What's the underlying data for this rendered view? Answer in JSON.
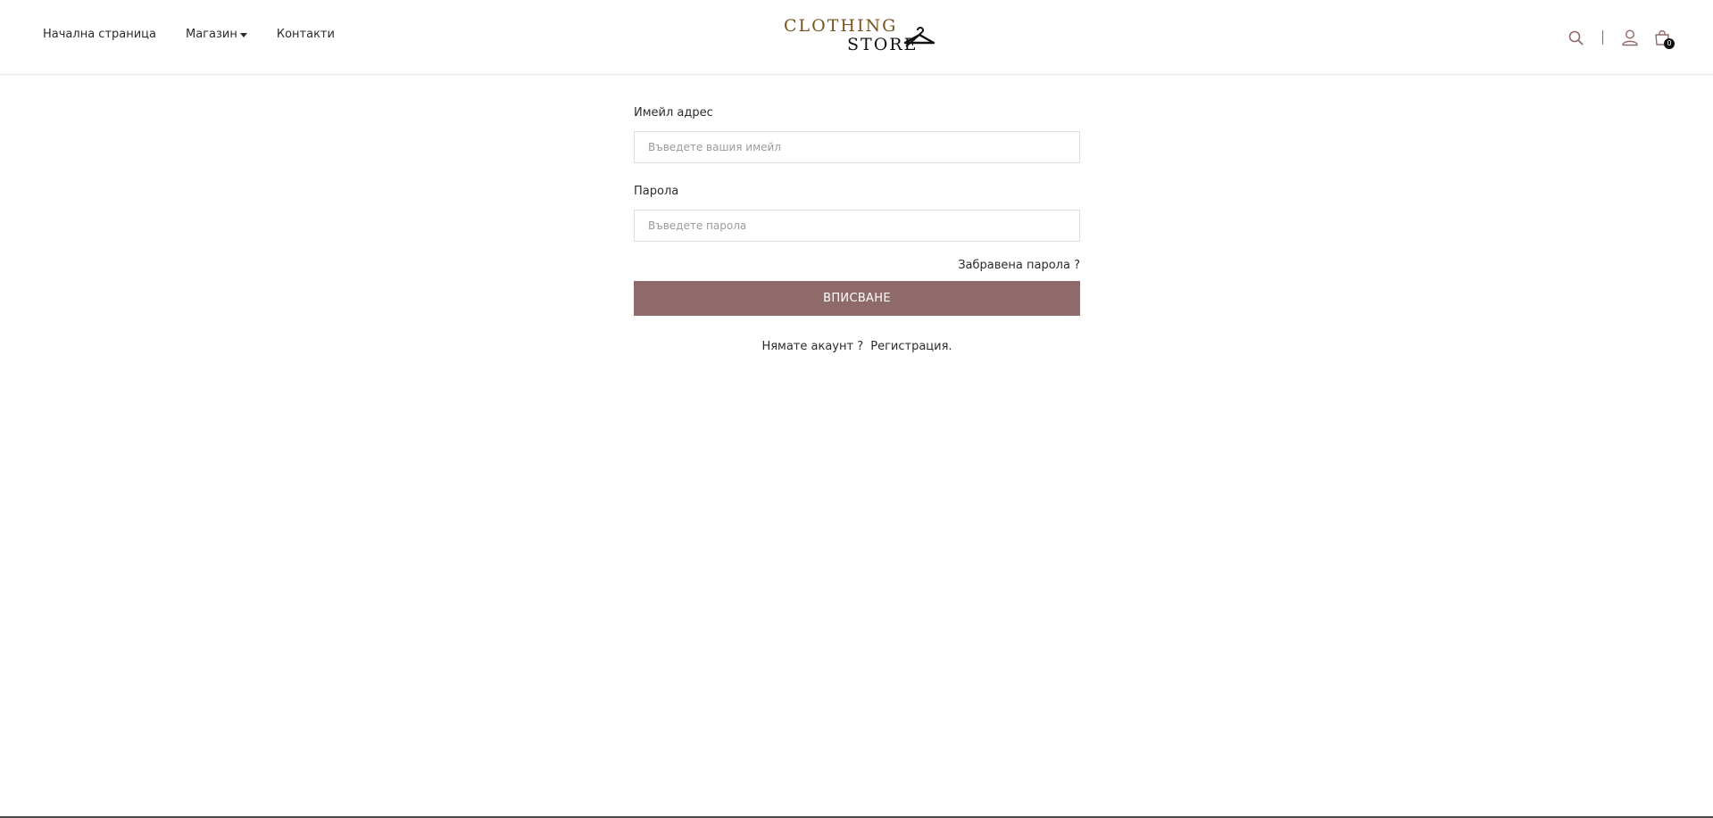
{
  "nav": {
    "home": "Начална страница",
    "shop": "Магазин",
    "contacts": "Контакти"
  },
  "logo": {
    "line1": "CLOTHING",
    "line2": "STORE"
  },
  "header_icons": {
    "search": "search-icon",
    "user": "user-icon",
    "cart": "cart-icon",
    "cart_count": "0"
  },
  "login_form": {
    "email_label": "Имейл адрес",
    "email_placeholder": "Въведете вашия имейл",
    "password_label": "Парола",
    "password_placeholder": "Въведете парола",
    "forgot_password": "Забравена парола ?",
    "submit_label": "ВПИСВАНЕ",
    "no_account_text": "Нямате акаунт ?",
    "register_link": "Регистрация."
  },
  "colors": {
    "accent": "#8f6a6a",
    "logo_gold": "#7a5420"
  }
}
